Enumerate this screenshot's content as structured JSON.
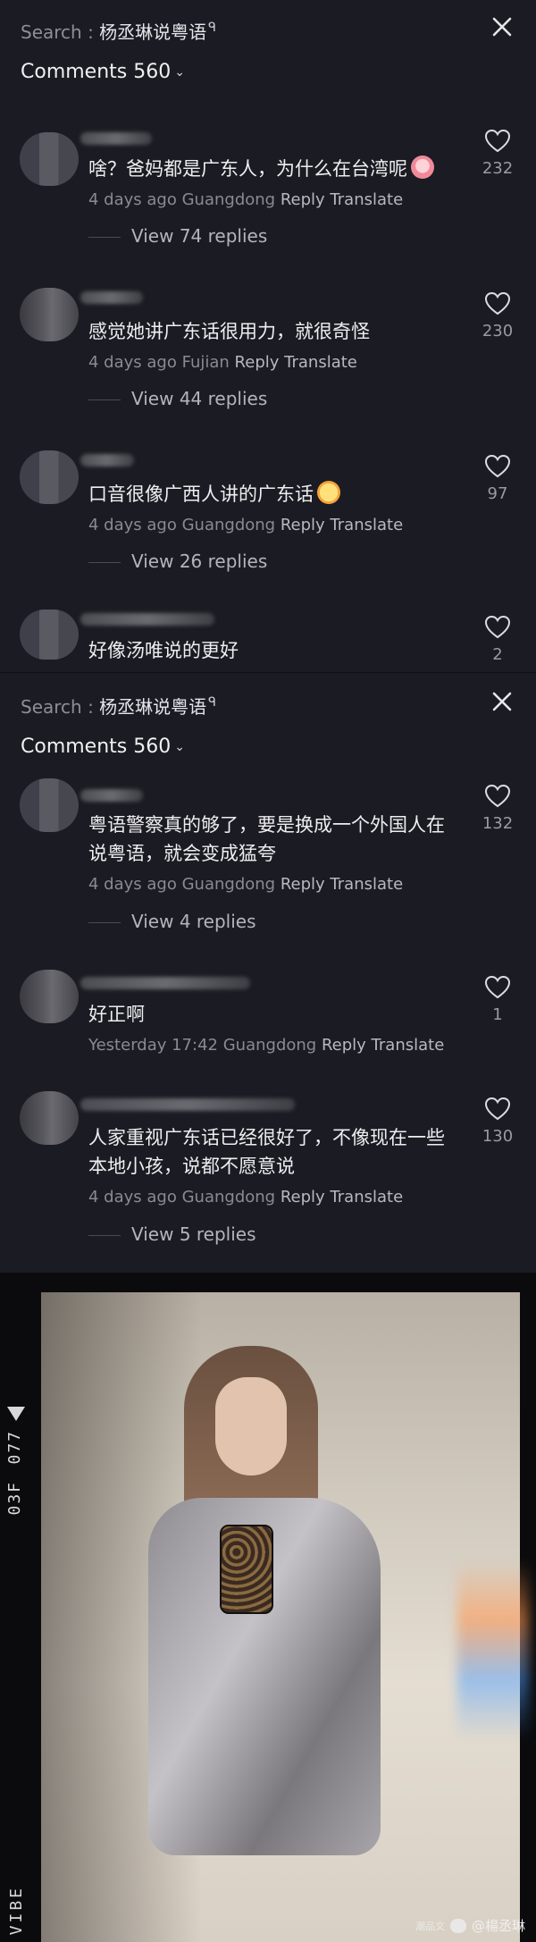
{
  "panel1": {
    "search_prefix": "Search : ",
    "search_query": "杨丞琳说粤语",
    "search_mag": "ᑫ",
    "comments_label": "Comments 560",
    "comments": [
      {
        "text": "啥？爸妈都是广东人，为什么在台湾呢",
        "emoji": "crying-face",
        "time": "4 days ago",
        "location": "Guangdong",
        "reply": "Reply",
        "translate": "Translate",
        "likes": "232",
        "replies": "View 74 replies"
      },
      {
        "text": "感觉她讲广东话很用力，就很奇怪",
        "time": "4 days ago",
        "location": "Fujian",
        "reply": "Reply",
        "translate": "Translate",
        "likes": "230",
        "replies": "View 44 replies"
      },
      {
        "text": "口音很像广西人讲的广东话",
        "emoji": "laughing-face",
        "time": "4 days ago",
        "location": "Guangdong",
        "reply": "Reply",
        "translate": "Translate",
        "likes": "97",
        "replies": "View 26 replies"
      },
      {
        "text": "好像汤唯说的更好",
        "likes": "2"
      }
    ]
  },
  "panel2": {
    "search_prefix": "Search : ",
    "search_query": "杨丞琳说粤语",
    "search_mag": "ᑫ",
    "comments_label": "Comments 560",
    "comments": [
      {
        "text_line1": "粤语警察真的够了，要是换成一个外国人在",
        "text_line2": "说粤语，就会变成猛夸",
        "time": "4 days ago",
        "location": "Guangdong",
        "reply": "Reply",
        "translate": "Translate",
        "likes": "132",
        "replies": "View 4 replies"
      },
      {
        "text_line1": "好正啊",
        "time": "Yesterday 17:42",
        "location": "Guangdong",
        "reply": "Reply",
        "translate": "Translate",
        "likes": "1"
      },
      {
        "text_line1": "人家重视广东话已经很好了，不像现在一些",
        "text_line2": "本地小孩，说都不愿意说",
        "time": "4 days ago",
        "location": "Guangdong",
        "reply": "Reply",
        "translate": "Translate",
        "likes": "130",
        "replies": "View 5 replies"
      }
    ]
  },
  "photo": {
    "film_code_1": "077",
    "film_code_2": "03F",
    "film_bottom": "VIBE",
    "watermark": "@楊丞琳",
    "small_logo": "潮品文"
  },
  "colors": {
    "background": "#1b1b23",
    "text": "#eeeef0",
    "meta": "#8a8a92"
  }
}
